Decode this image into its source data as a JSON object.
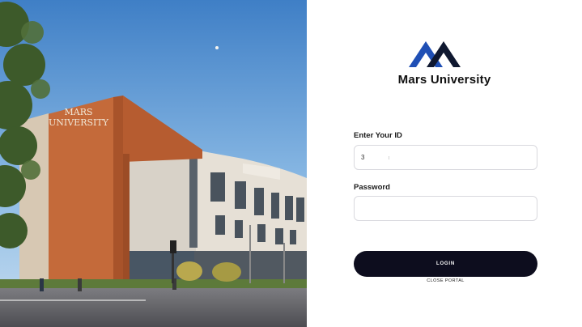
{
  "hero": {
    "building_sign_line1": "MARS",
    "building_sign_line2": "UNIVERSITY"
  },
  "brand": {
    "name": "Mars University",
    "logo_colors": [
      "#1f4fb5",
      "#0f1830"
    ]
  },
  "form": {
    "id_label": "Enter Your ID",
    "id_value": "3",
    "password_label": "Password",
    "password_value": "",
    "login_label": "LOGIN",
    "close_label": "CLOSE PORTAL"
  },
  "colors": {
    "button_bg": "#0d0d1e",
    "field_border": "#d9d9de"
  }
}
